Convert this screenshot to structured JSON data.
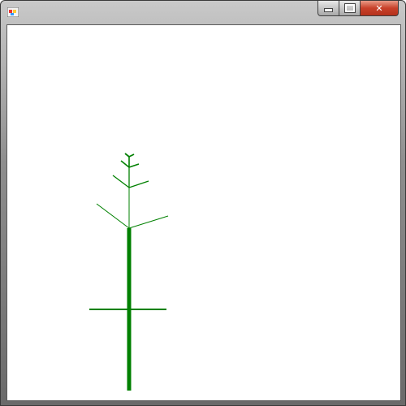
{
  "window": {
    "title": "",
    "buttons": {
      "minimize": "minimize",
      "maximize": "maximize",
      "close": "close"
    }
  },
  "canvas": {
    "drawing": "fractal-tree",
    "stroke_color": "#008000",
    "background": "#ffffff"
  }
}
